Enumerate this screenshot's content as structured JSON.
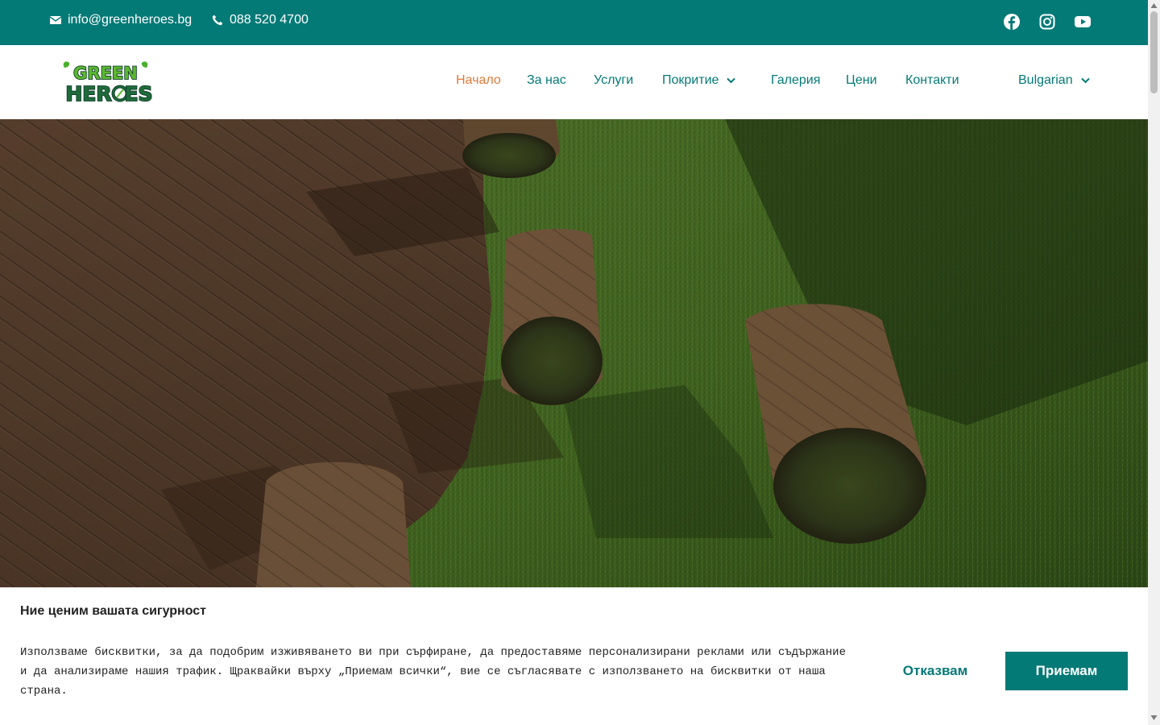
{
  "topbar": {
    "email": "info@greenheroes.bg",
    "phone": "088 520 4700",
    "social_icons": [
      "facebook-icon",
      "instagram-icon",
      "youtube-icon"
    ],
    "background_color": "#047a77"
  },
  "logo": {
    "line1": "GREEN",
    "line2": "HER",
    "line3": "ES"
  },
  "nav": {
    "items": [
      {
        "label": "Начало",
        "active": true
      },
      {
        "label": "За нас"
      },
      {
        "label": "Услуги"
      },
      {
        "label": "Покритие",
        "has_dropdown": true
      },
      {
        "label": "Галерия"
      },
      {
        "label": "Цени"
      },
      {
        "label": "Контакти"
      }
    ],
    "language": "Bulgarian",
    "active_color": "#e0793a",
    "link_color": "#047a77"
  },
  "cookie": {
    "title": "Ние ценим вашата сигурност",
    "text": "Използваме бисквитки, за да подобрим изживяването ви при сърфиране, да предоставяме персонализирани реклами или съдържание и да анализираме нашия трафик. Щраквайки върху „Приемам всички“, вие се съгласявате с използването на бисквитки от наша страна.",
    "decline_label": "Отказвам",
    "accept_label": "Приемам"
  }
}
